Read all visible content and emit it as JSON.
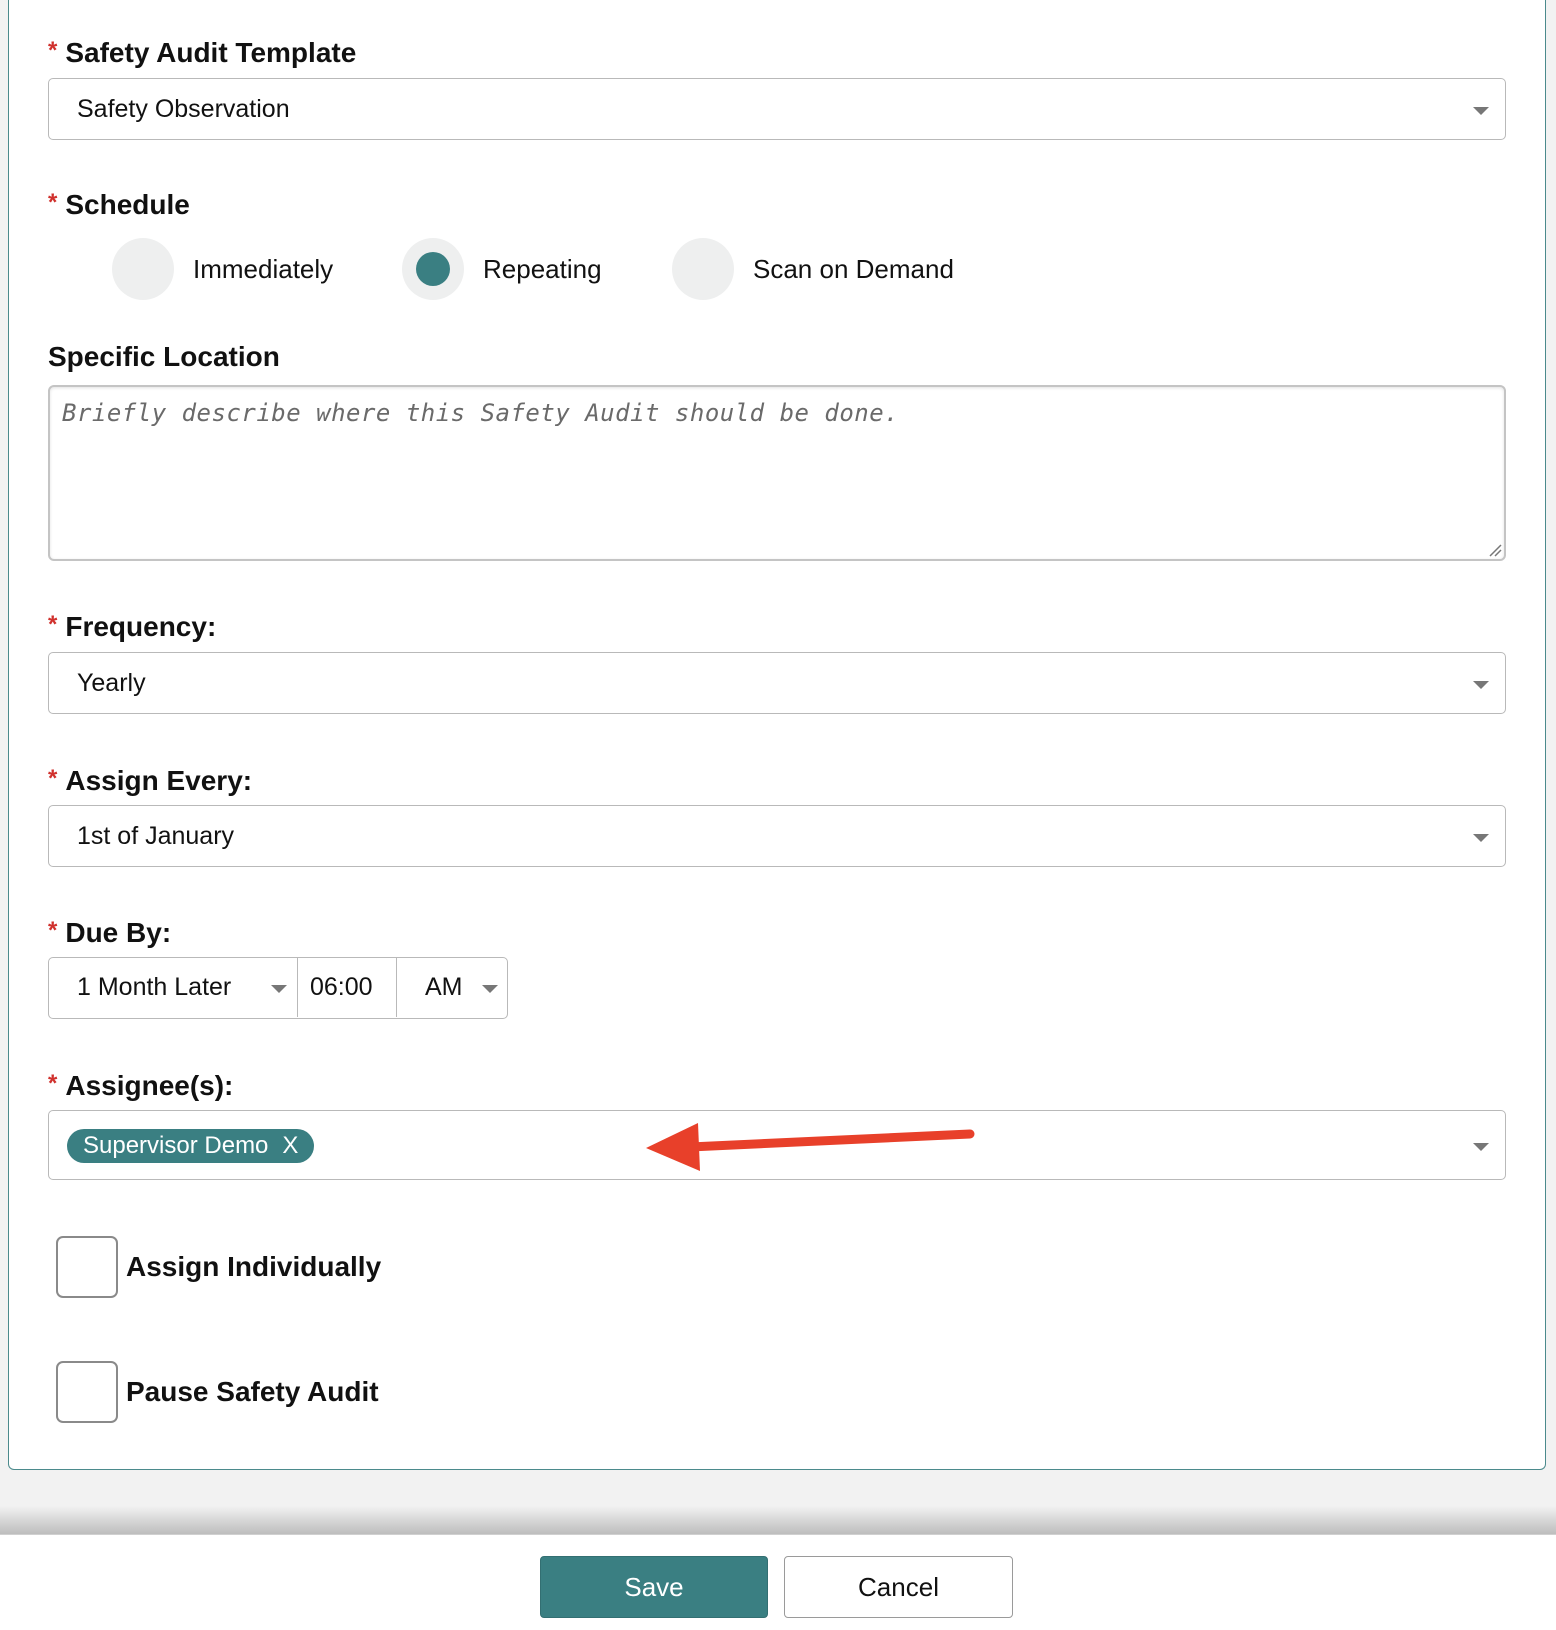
{
  "form": {
    "template": {
      "required_mark": "*",
      "label": "Safety Audit Template",
      "value": "Safety Observation"
    },
    "schedule": {
      "required_mark": "*",
      "label": "Schedule",
      "options": [
        {
          "label": "Immediately",
          "selected": false
        },
        {
          "label": "Repeating",
          "selected": true
        },
        {
          "label": "Scan on Demand",
          "selected": false
        }
      ]
    },
    "location": {
      "label": "Specific Location",
      "placeholder": "Briefly describe where this Safety Audit should be done."
    },
    "frequency": {
      "required_mark": "*",
      "label": "Frequency:",
      "value": "Yearly"
    },
    "assign_every": {
      "required_mark": "*",
      "label": "Assign Every:",
      "value": "1st of January"
    },
    "due_by": {
      "required_mark": "*",
      "label": "Due By:",
      "offset": "1 Month Later",
      "time": "06:00",
      "meridiem": "AM"
    },
    "assignees": {
      "required_mark": "*",
      "label": "Assignee(s):",
      "chips": [
        {
          "label": "Supervisor Demo",
          "remove": "X"
        }
      ]
    },
    "assign_individually": {
      "label": "Assign Individually",
      "checked": false
    },
    "pause_audit": {
      "label": "Pause Safety Audit",
      "checked": false
    }
  },
  "footer": {
    "save_label": "Save",
    "cancel_label": "Cancel"
  },
  "colors": {
    "accent": "#3a7f82",
    "required": "#d0312d",
    "annotation_arrow": "#e8402a"
  }
}
